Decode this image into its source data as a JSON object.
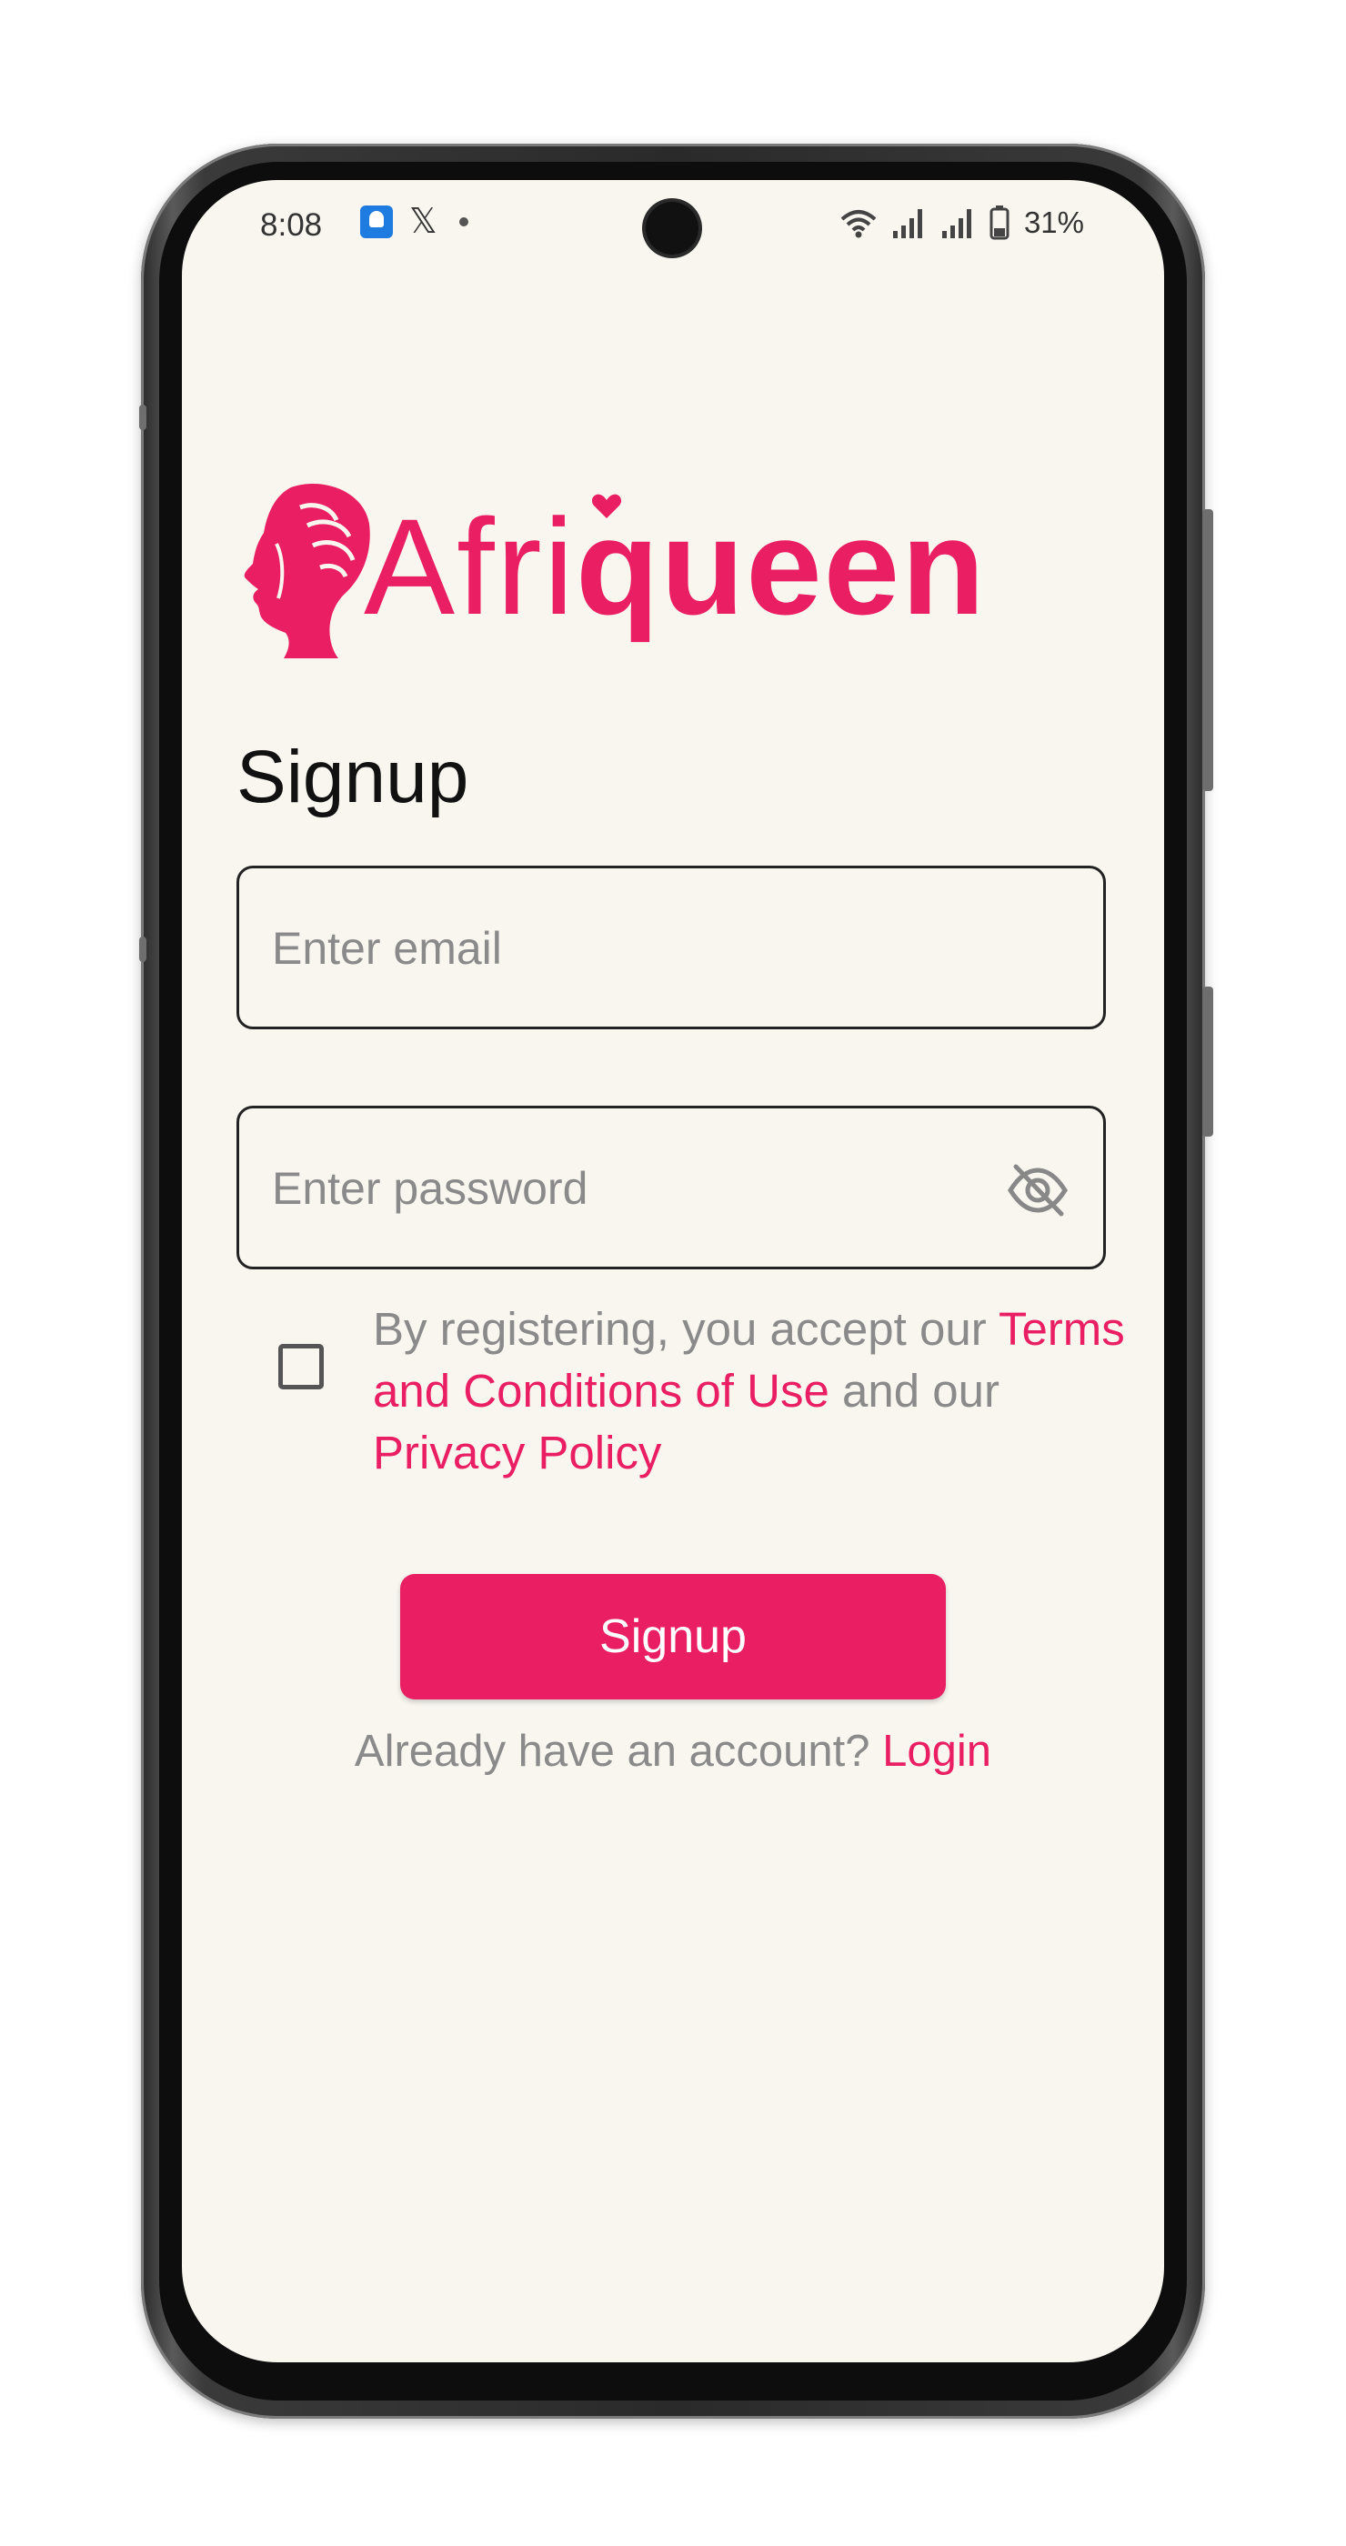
{
  "status_bar": {
    "time": "8:08",
    "battery_percent": "31%",
    "notification_icons": [
      "app-icon",
      "x-icon",
      "dot-icon"
    ],
    "system_icons": [
      "wifi-icon",
      "signal-icon",
      "signal-icon",
      "battery-icon"
    ]
  },
  "brand": {
    "logo_part_light": "Afri",
    "logo_part_bold": "queen",
    "accent_color": "#e91e63"
  },
  "signup": {
    "title": "Signup",
    "email_placeholder": "Enter email",
    "email_value": "",
    "password_placeholder": "Enter password",
    "password_value": "",
    "password_toggle_icon": "eye-off-icon",
    "terms_checked": false,
    "terms_prefix": "By registering, you accept our ",
    "terms_link": "Terms and Conditions of Use",
    "terms_middle": " and our ",
    "privacy_link": "Privacy Policy",
    "button_label": "Signup",
    "login_prompt": "Already have an account? ",
    "login_link": "Login"
  }
}
